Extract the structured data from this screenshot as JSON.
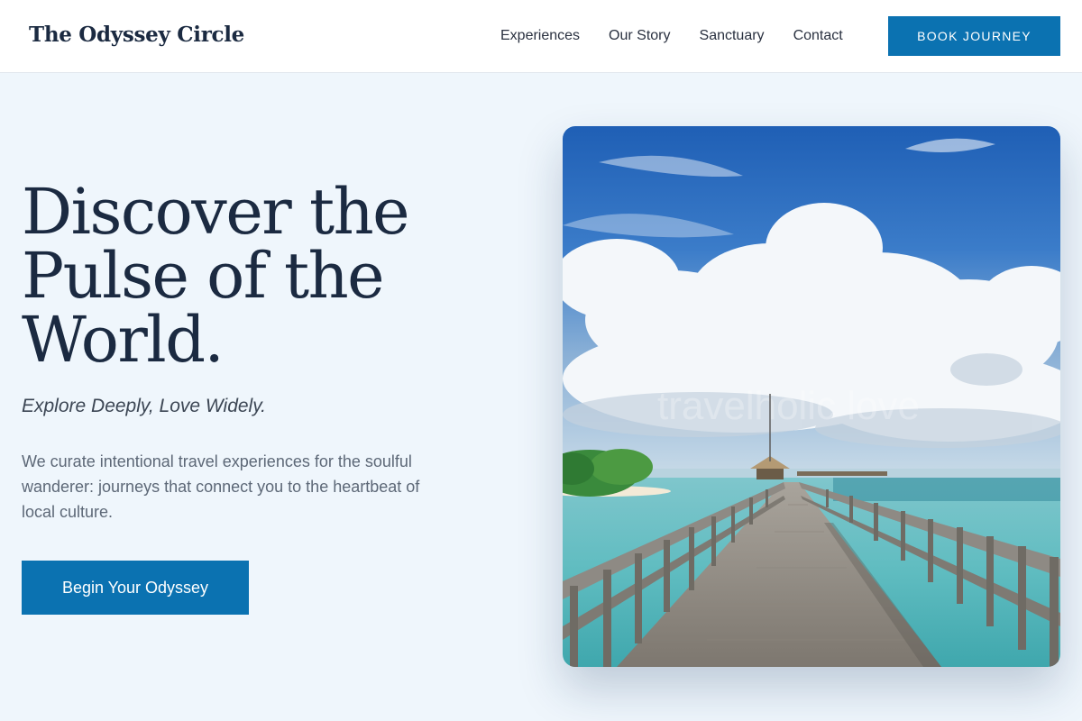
{
  "brand": {
    "name": "The Odyssey Circle"
  },
  "nav": {
    "items": [
      {
        "label": "Experiences"
      },
      {
        "label": "Our Story"
      },
      {
        "label": "Sanctuary"
      },
      {
        "label": "Contact"
      }
    ],
    "cta_label": "BOOK JOURNEY"
  },
  "hero": {
    "title_lines": [
      "Discover the",
      "Pulse of the",
      "World."
    ],
    "tagline": "Explore Deeply, Love Widely.",
    "description": "We curate intentional travel experiences for the soulful wanderer: journeys that connect you to the heartbeat of local culture.",
    "cta_label": "Begin Your Odyssey",
    "image": {
      "subject": "wooden pier over turquoise sea with clouds",
      "watermark": "travelholic love"
    }
  },
  "colors": {
    "accent": "#0b72b1",
    "heading": "#1b2a41",
    "page_background": "#eff6fc",
    "header_background": "#ffffff"
  }
}
